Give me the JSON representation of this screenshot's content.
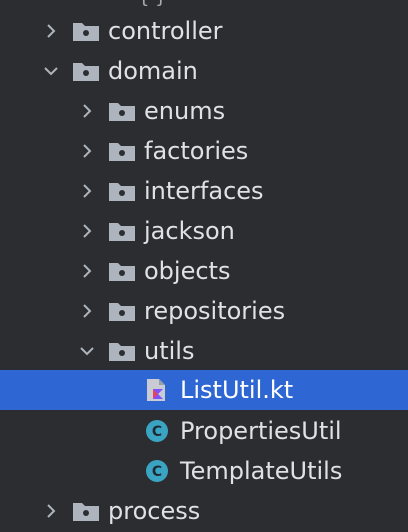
{
  "project_tree": {
    "items": [
      {
        "label": "controller",
        "icon": "folder-icon",
        "expanded": false
      },
      {
        "label": "domain",
        "icon": "folder-icon",
        "expanded": true
      },
      {
        "label": "enums",
        "icon": "folder-icon",
        "expanded": false
      },
      {
        "label": "factories",
        "icon": "folder-icon",
        "expanded": false
      },
      {
        "label": "interfaces",
        "icon": "folder-icon",
        "expanded": false
      },
      {
        "label": "jackson",
        "icon": "folder-icon",
        "expanded": false
      },
      {
        "label": "objects",
        "icon": "folder-icon",
        "expanded": false
      },
      {
        "label": "repositories",
        "icon": "folder-icon",
        "expanded": false
      },
      {
        "label": "utils",
        "icon": "folder-icon",
        "expanded": true
      },
      {
        "label": "ListUtil.kt",
        "icon": "kotlin-file-icon",
        "selected": true
      },
      {
        "label": "PropertiesUtil",
        "icon": "kotlin-class-icon"
      },
      {
        "label": "TemplateUtils",
        "icon": "kotlin-class-icon"
      },
      {
        "label": "process",
        "icon": "folder-icon",
        "expanded": false
      }
    ]
  },
  "colors": {
    "background": "#2b2d30",
    "selection": "#2e67d3",
    "text": "#dfe1e5",
    "folder": "#aeb4bd",
    "class_badge": "#3aa5c3"
  }
}
